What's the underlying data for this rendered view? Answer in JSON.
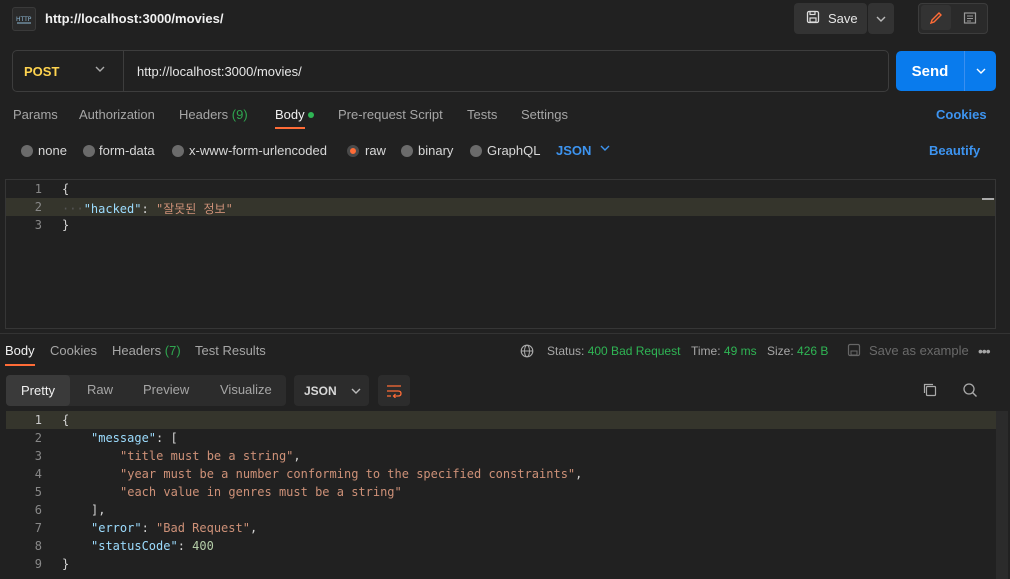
{
  "header": {
    "request_title": "http://localhost:3000/movies/",
    "save_label": "Save"
  },
  "request": {
    "method": "POST",
    "url": "http://localhost:3000/movies/",
    "send_label": "Send"
  },
  "request_tabs": {
    "params": "Params",
    "authorization": "Authorization",
    "headers": "Headers",
    "headers_count": "(9)",
    "body": "Body",
    "prerequest": "Pre-request Script",
    "tests": "Tests",
    "settings": "Settings",
    "cookies": "Cookies"
  },
  "body_types": {
    "none": "none",
    "form_data": "form-data",
    "urlencoded": "x-www-form-urlencoded",
    "raw": "raw",
    "binary": "binary",
    "graphql": "GraphQL",
    "format": "JSON",
    "beautify": "Beautify",
    "selected": "raw"
  },
  "request_body": {
    "line_numbers": [
      "1",
      "2",
      "3"
    ],
    "open": "{",
    "key": "\"hacked\"",
    "colon": ": ",
    "value": "\"잘못된 정보\"",
    "close": "}"
  },
  "response_tabs": {
    "body": "Body",
    "cookies": "Cookies",
    "headers": "Headers",
    "headers_count": "(7)",
    "test_results": "Test Results"
  },
  "response_meta": {
    "status_label": "Status:",
    "status_value": "400 Bad Request",
    "time_label": "Time:",
    "time_value": "49 ms",
    "size_label": "Size:",
    "size_value": "426 B",
    "save_example": "Save as example"
  },
  "response_view": {
    "pretty": "Pretty",
    "raw": "Raw",
    "preview": "Preview",
    "visualize": "Visualize",
    "format": "JSON"
  },
  "response_body": {
    "line_numbers": [
      "1",
      "2",
      "3",
      "4",
      "5",
      "6",
      "7",
      "8",
      "9"
    ],
    "l1": "{",
    "message_key": "\"message\"",
    "message_open": ": [",
    "msg1": "\"title must be a string\"",
    "msg2": "\"year must be a number conforming to the specified constraints\"",
    "msg3": "\"each value in genres must be a string\"",
    "comma": ",",
    "close_bracket": "],",
    "error_key": "\"error\"",
    "error_value": "\"Bad Request\"",
    "status_key": "\"statusCode\"",
    "status_value": "400",
    "l9": "}"
  },
  "colors": {
    "accent_orange": "#ff6c37",
    "send_blue": "#097bed",
    "method_yellow": "#ffd44f",
    "success_green": "#2fb554"
  }
}
